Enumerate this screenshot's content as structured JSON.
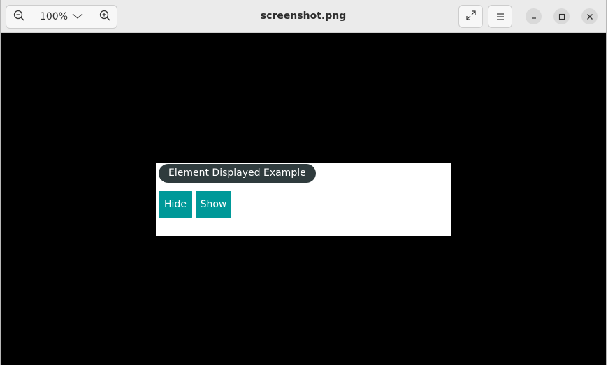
{
  "window": {
    "title": "screenshot.png"
  },
  "toolbar": {
    "zoom_level": "100%",
    "zoom_out_icon": "zoom-out-icon",
    "zoom_in_icon": "zoom-in-icon",
    "zoom_dropdown_icon": "chevron-down-icon",
    "fullscreen_icon": "fullscreen-icon",
    "menu_icon": "hamburger-menu-icon",
    "minimize_icon": "minimize-icon",
    "maximize_icon": "maximize-icon",
    "close_icon": "close-icon"
  },
  "image": {
    "heading": "Element Displayed Example",
    "hide_label": "Hide",
    "show_label": "Show",
    "colors": {
      "heading_bg": "#2f3b3d",
      "button_bg": "#009999",
      "viewer_bg": "#000000"
    }
  }
}
